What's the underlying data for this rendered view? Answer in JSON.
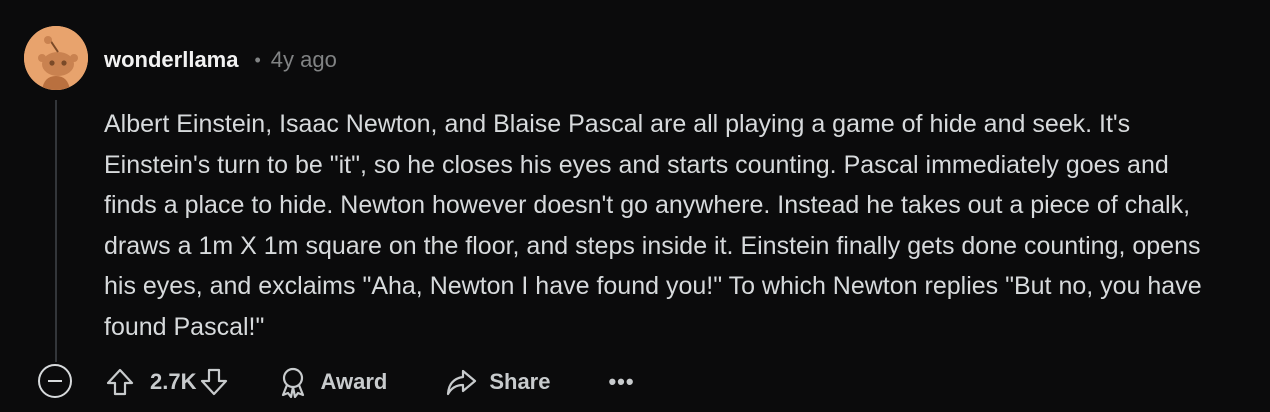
{
  "comment": {
    "username": "wonderllama",
    "separator": "•",
    "timestamp": "4y ago",
    "body": "Albert Einstein, Isaac Newton, and Blaise Pascal are all playing a game of hide and seek. It's Einstein's turn to be \"it\", so he closes his eyes and starts counting. Pascal immediately goes and finds a place to hide. Newton however doesn't go anywhere. Instead he takes out a piece of chalk, draws a 1m X 1m square on the floor, and steps inside it. Einstein finally gets done counting, opens his eyes, and exclaims \"Aha, Newton I have found you!\" To which Newton replies \"But no, you have found Pascal!\""
  },
  "actions": {
    "score": "2.7K",
    "award_label": "Award",
    "share_label": "Share",
    "more_label": "•••"
  },
  "icons": {
    "avatar": "snoo-avatar-icon",
    "collapse": "collapse-minus-icon",
    "upvote": "upvote-arrow-icon",
    "downvote": "downvote-arrow-icon",
    "award": "award-ribbon-icon",
    "share": "share-arrow-icon",
    "more": "more-dots-icon"
  },
  "colors": {
    "background": "#0b0b0c",
    "avatar_bg": "#e8a36d",
    "text": "#d7dadc",
    "muted": "#818384"
  }
}
